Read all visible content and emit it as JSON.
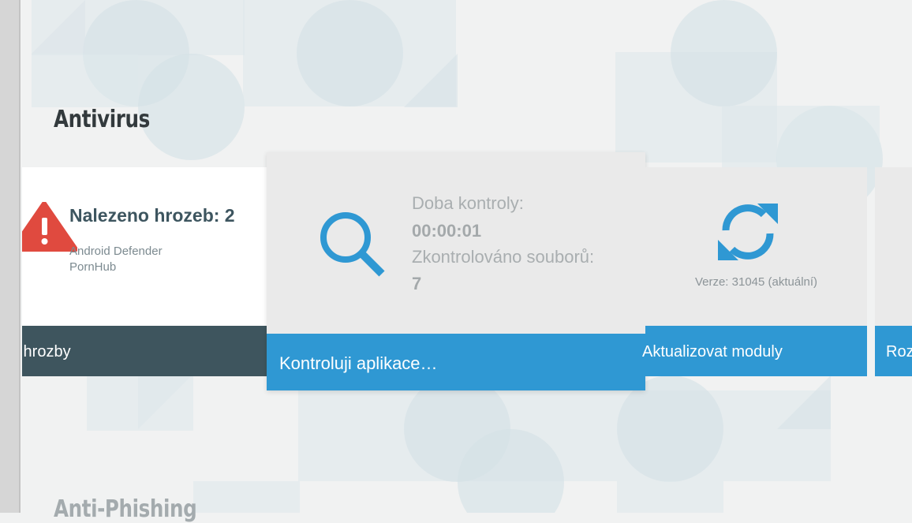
{
  "section": {
    "title": "Antivirus",
    "next_title": "Anti-Phishing"
  },
  "threats": {
    "heading": "Nalezeno hrozeb: 2",
    "items": [
      "Android Defender",
      "PornHub"
    ],
    "action_label": "it hrozby",
    "icon": "warning-icon",
    "color": "#e04a3f"
  },
  "scan": {
    "time_label": "Doba kontroly:",
    "time_value": "00:00:01",
    "files_label": "Zkontrolováno souborů:",
    "files_value": "7",
    "action_label": "Kontroluji aplikace…",
    "icon": "magnifier-icon",
    "color": "#2f98d3"
  },
  "update": {
    "version_text": "Verze: 31045 (aktuální)",
    "action_label": "Aktualizovat moduly",
    "icon": "sync-icon",
    "color": "#2f98d3"
  },
  "partial": {
    "action_label": "Roz"
  },
  "colors": {
    "dark_button": "#3e555e",
    "accent": "#2f98d3",
    "background": "#f1f2f2"
  }
}
